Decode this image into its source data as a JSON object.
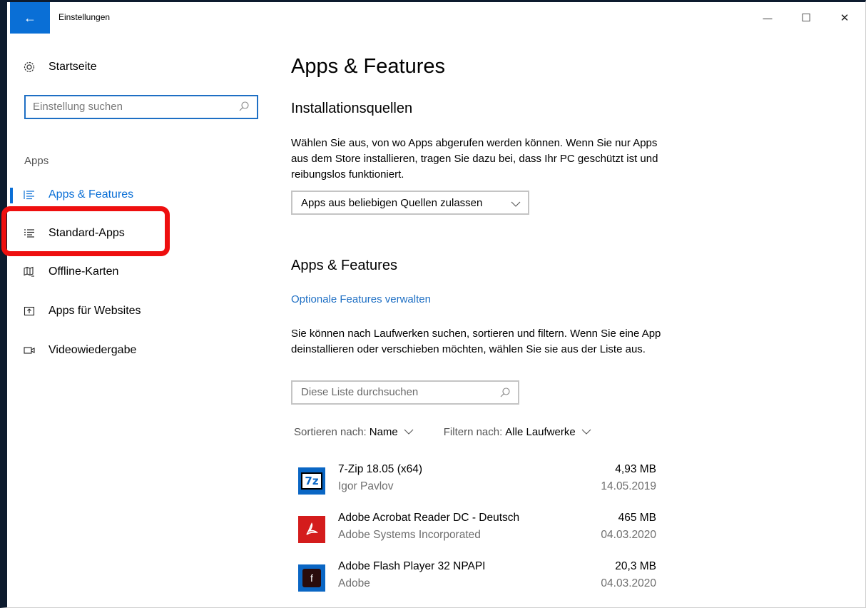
{
  "window": {
    "title": "Einstellungen",
    "back_glyph": "←",
    "minimize_glyph": "—",
    "maximize_glyph": "☐",
    "close_glyph": "✕"
  },
  "sidebar": {
    "home_label": "Startseite",
    "search_placeholder": "Einstellung suchen",
    "section_label": "Apps",
    "items": [
      {
        "label": "Apps & Features",
        "icon": "list-icon",
        "active": true
      },
      {
        "label": "Standard-Apps",
        "icon": "default-apps-icon",
        "active": false
      },
      {
        "label": "Offline-Karten",
        "icon": "map-icon",
        "active": false
      },
      {
        "label": "Apps für Websites",
        "icon": "web-app-icon",
        "active": false
      },
      {
        "label": "Videowiedergabe",
        "icon": "video-icon",
        "active": false
      }
    ]
  },
  "main": {
    "page_title": "Apps & Features",
    "install_sources": {
      "title": "Installationsquellen",
      "description": "Wählen Sie aus, von wo Apps abgerufen werden können. Wenn Sie nur Apps aus dem Store installieren, tragen Sie dazu bei, dass Ihr PC geschützt ist und reibungslos funktioniert.",
      "dropdown_value": "Apps aus beliebigen Quellen zulassen"
    },
    "apps_features": {
      "title": "Apps & Features",
      "optional_link": "Optionale Features verwalten",
      "description": "Sie können nach Laufwerken suchen, sortieren und filtern. Wenn Sie eine App deinstallieren oder verschieben möchten, wählen Sie sie aus der Liste aus.",
      "search_placeholder": "Diese Liste durchsuchen",
      "sort_label": "Sortieren nach:",
      "sort_value": "Name",
      "filter_label": "Filtern nach:",
      "filter_value": "Alle Laufwerke"
    },
    "apps": [
      {
        "name": "7-Zip 18.05 (x64)",
        "publisher": "Igor Pavlov",
        "size": "4,93 MB",
        "date": "14.05.2019",
        "icon": "7zip-icon",
        "icon_text": "7z"
      },
      {
        "name": "Adobe Acrobat Reader DC - Deutsch",
        "publisher": "Adobe Systems Incorporated",
        "size": "465 MB",
        "date": "04.03.2020",
        "icon": "acrobat-icon"
      },
      {
        "name": "Adobe Flash Player 32 NPAPI",
        "publisher": "Adobe",
        "size": "20,3 MB",
        "date": "04.03.2020",
        "icon": "flash-icon",
        "icon_text": "f"
      }
    ]
  },
  "colors": {
    "accent": "#0a6fd6",
    "highlight": "#ee0f0f",
    "link": "#1e6fc4"
  }
}
